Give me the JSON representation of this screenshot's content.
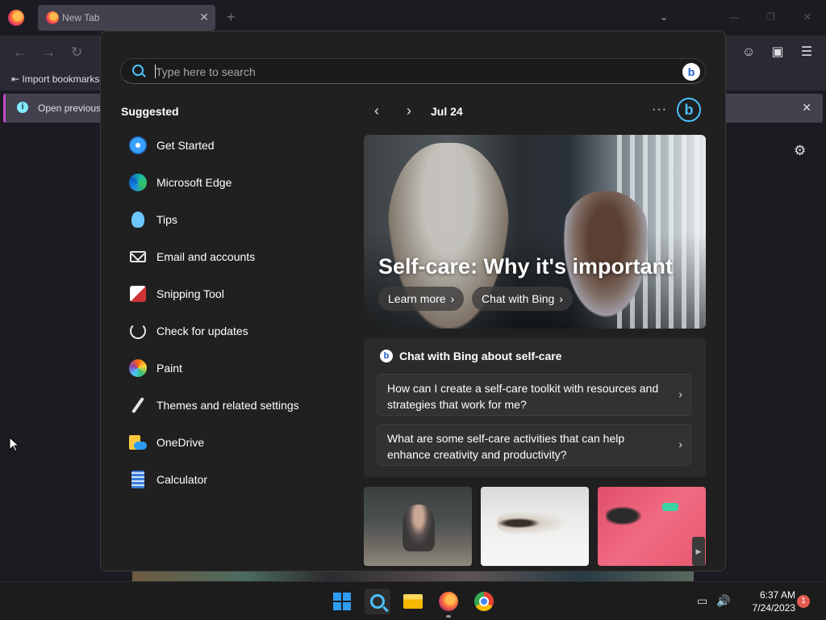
{
  "browser": {
    "tab_title": "New Tab",
    "tab_close": "✕",
    "new_tab": "+",
    "bookmarks_item": "Import bookmarks...",
    "info_text": "Open previous",
    "info_close": "✕"
  },
  "search": {
    "placeholder": "Type here to search",
    "bing_label": "b"
  },
  "suggested": {
    "title": "Suggested",
    "items": [
      {
        "label": "Get Started",
        "icon": "get-started-icon"
      },
      {
        "label": "Microsoft Edge",
        "icon": "edge-icon"
      },
      {
        "label": "Tips",
        "icon": "tips-icon"
      },
      {
        "label": "Email and accounts",
        "icon": "mail-icon"
      },
      {
        "label": "Snipping Tool",
        "icon": "snipping-tool-icon"
      },
      {
        "label": "Check for updates",
        "icon": "update-icon"
      },
      {
        "label": "Paint",
        "icon": "paint-icon"
      },
      {
        "label": "Themes and related settings",
        "icon": "brush-icon"
      },
      {
        "label": "OneDrive",
        "icon": "onedrive-icon"
      },
      {
        "label": "Calculator",
        "icon": "calculator-icon"
      }
    ]
  },
  "highlights": {
    "prev": "‹",
    "next": "›",
    "date": "Jul 24",
    "more": "···",
    "bing": "b",
    "hero_title": "Self-care: Why it's important",
    "learn_more": "Learn more",
    "chat_with_bing": "Chat with Bing",
    "chev": "›"
  },
  "chat": {
    "header": "Chat with Bing about self-care",
    "questions": [
      "How can I create a self-care toolkit with resources and strategies that work for me?",
      "What are some self-care activities that can help enhance creativity and productivity?"
    ],
    "chev": "›"
  },
  "taskbar": {
    "time": "6:37 AM",
    "date": "7/24/2023",
    "notifications": "1"
  },
  "colors": {
    "accent": "#4cc2ff",
    "panel_bg": "#202020",
    "taskbar_bg": "#1c1c1c"
  }
}
